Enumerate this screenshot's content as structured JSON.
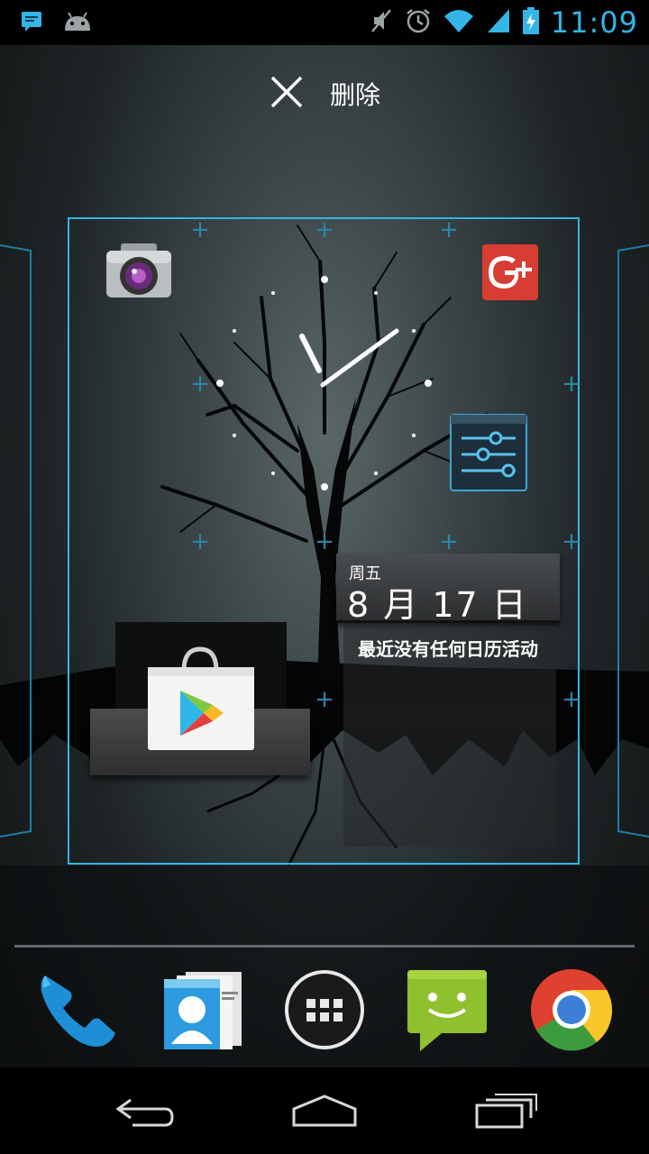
{
  "status_bar": {
    "time": "11:09",
    "icons": [
      "message-notification-icon",
      "android-debug-icon",
      "mute-icon",
      "alarm-icon",
      "wifi-icon",
      "signal-icon",
      "battery-charging-icon"
    ]
  },
  "delete_target": {
    "label": "删除",
    "icon": "close-icon"
  },
  "workspace": {
    "apps": [
      {
        "name": "camera-icon"
      },
      {
        "name": "google-plus-icon"
      },
      {
        "name": "settings-icon"
      },
      {
        "name": "play-store-icon"
      }
    ],
    "clock_widget": {
      "hour_hand": 11,
      "minute_hand": 9
    },
    "calendar_widget": {
      "weekday": "周五",
      "date": "8 月 17 日",
      "empty_text": "最近没有任何日历活动"
    }
  },
  "dock": {
    "items": [
      "phone-icon",
      "contacts-icon",
      "all-apps-icon",
      "messaging-icon",
      "chrome-icon"
    ]
  },
  "nav_bar": {
    "buttons": [
      "back-icon",
      "home-icon",
      "recents-icon"
    ]
  },
  "colors": {
    "accent": "#33b5e5",
    "status_bar_bg": "#000000",
    "nav_bar_bg": "#000000"
  }
}
